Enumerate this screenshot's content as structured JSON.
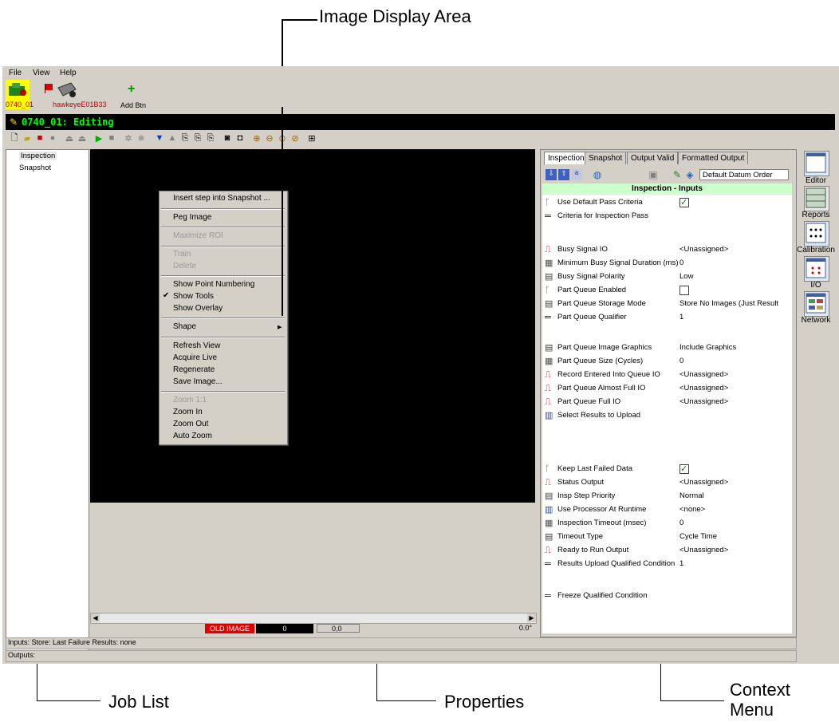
{
  "callouts": {
    "image_display_area": "Image Display Area",
    "job_list": "Job List",
    "properties": "Properties",
    "context_menu_line1": "Context",
    "context_menu_line2": "Menu"
  },
  "menubar": {
    "file": "File",
    "view": "View",
    "help": "Help"
  },
  "device_bar": {
    "device1": "0740_01",
    "device2": "hawkeyeE01B33",
    "add_btn": "Add Btn"
  },
  "job_title": "0740_01: Editing",
  "job_list": {
    "items": [
      "Inspection",
      "Snapshot"
    ]
  },
  "context_menu": {
    "insert_step": "Insert step into Snapshot ...",
    "peg_image": "Peg Image",
    "maximize_roi": "Maximize ROI",
    "train": "Train",
    "delete": "Delete",
    "show_point_numbering": "Show Point Numbering",
    "show_tools": "Show Tools",
    "show_overlay": "Show Overlay",
    "shape": "Shape",
    "refresh_view": "Refresh View",
    "acquire_live": "Acquire Live",
    "regenerate": "Regenerate",
    "save_image": "Save Image...",
    "zoom_1_1": "Zoom 1:1",
    "zoom_in": "Zoom In",
    "zoom_out": "Zoom Out",
    "auto_zoom": "Auto Zoom"
  },
  "image_status": {
    "old_image": "OLD IMAGE",
    "value": "0",
    "coords": "0,0",
    "angle": "0.0°"
  },
  "properties": {
    "tabs": [
      "Inspection",
      "Snapshot",
      "Output Valid",
      "Formatted Output"
    ],
    "datum_order": "Default Datum Order",
    "section_title": "Inspection - Inputs",
    "rows": [
      {
        "name": "Use Default Pass Criteria",
        "value": "",
        "icon": "bool-icon",
        "check": true
      },
      {
        "name": "Criteria for Inspection Pass",
        "value": "",
        "icon": "equals-icon"
      },
      {
        "name": "Busy Signal IO",
        "value": "<Unassigned>",
        "icon": "pulse-icon"
      },
      {
        "name": "Minimum Busy Signal Duration (ms)",
        "value": "0",
        "icon": "number-icon"
      },
      {
        "name": "Busy Signal Polarity",
        "value": "Low",
        "icon": "list-icon"
      },
      {
        "name": "Part Queue Enabled",
        "value": "",
        "icon": "bool-icon",
        "check": false
      },
      {
        "name": "Part Queue Storage Mode",
        "value": "Store No Images (Just Result",
        "icon": "list-icon"
      },
      {
        "name": "Part Queue Qualifier",
        "value": "1",
        "icon": "equals-icon"
      },
      {
        "name": "Part Queue Image Graphics",
        "value": "Include Graphics",
        "icon": "list-icon"
      },
      {
        "name": "Part Queue Size (Cycles)",
        "value": "0",
        "icon": "number-icon"
      },
      {
        "name": "Record Entered Into Queue IO",
        "value": "<Unassigned>",
        "icon": "pulse-icon"
      },
      {
        "name": "Part Queue Almost Full IO",
        "value": "<Unassigned>",
        "icon": "pulse-icon"
      },
      {
        "name": "Part Queue Full IO",
        "value": "<Unassigned>",
        "icon": "pulse-icon"
      },
      {
        "name": "Select Results to Upload",
        "value": "",
        "icon": "table-icon"
      },
      {
        "name": "Keep Last Failed Data",
        "value": "",
        "icon": "bool-icon",
        "check": true
      },
      {
        "name": "Status Output",
        "value": "<Unassigned>",
        "icon": "pulse-icon"
      },
      {
        "name": "Insp Step Priority",
        "value": "Normal",
        "icon": "list-icon"
      },
      {
        "name": "Use Processor At Runtime",
        "value": "<none>",
        "icon": "table-icon"
      },
      {
        "name": "Inspection Timeout (msec)",
        "value": "0",
        "icon": "number-icon"
      },
      {
        "name": "Timeout Type",
        "value": "Cycle Time",
        "icon": "list-icon"
      },
      {
        "name": "Ready to Run Output",
        "value": "<Unassigned>",
        "icon": "pulse-icon"
      },
      {
        "name": "Results Upload Qualified Condition",
        "value": "1",
        "icon": "equals-icon"
      },
      {
        "name": "Freeze Qualified Condition",
        "value": "",
        "icon": "equals-icon"
      }
    ]
  },
  "right_bar": {
    "editor": "Editor",
    "reports": "Reports",
    "calibration": "Calibration",
    "io": "I/O",
    "network": "Network"
  },
  "status_bar": {
    "inputs": "Inputs: Store: Last Failure  Results: none",
    "outputs": "Outputs:"
  },
  "colors": {
    "accent_green": "#00ff00",
    "red": "#e00000",
    "section_bg": "#ccffcc"
  }
}
